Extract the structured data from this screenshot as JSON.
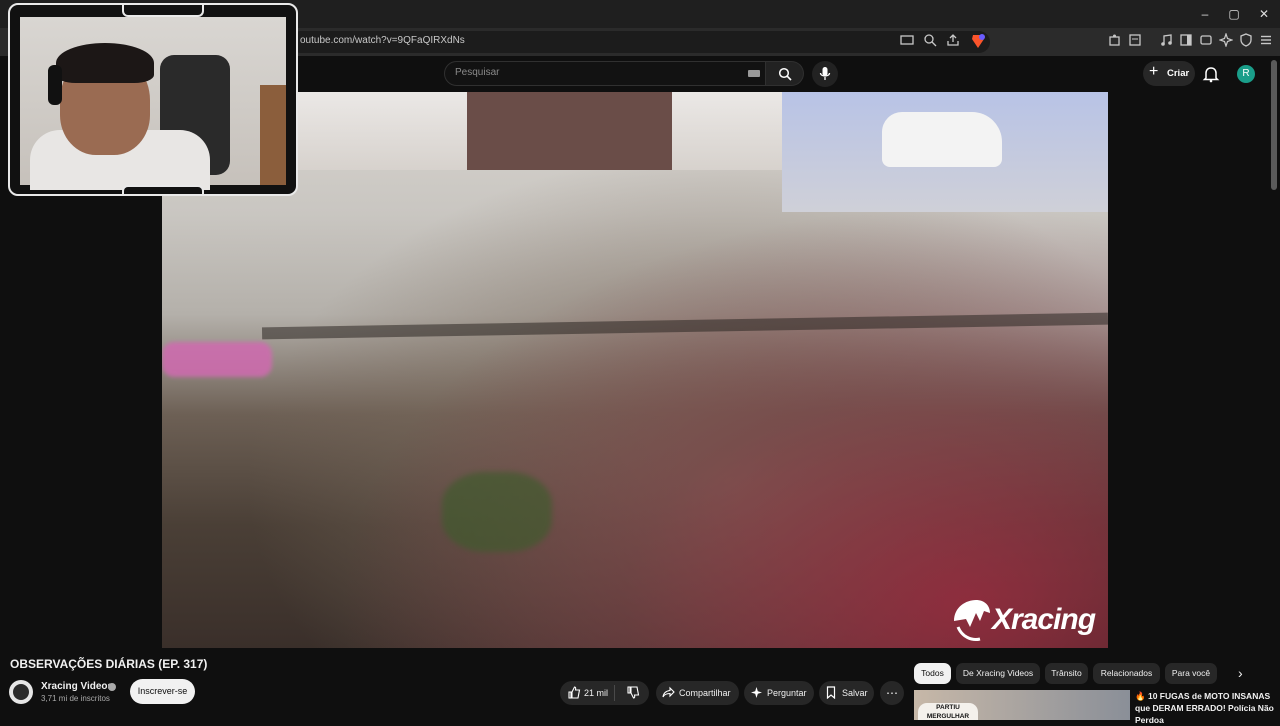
{
  "browser": {
    "url": "outube.com/watch?v=9QFaQIRXdNs",
    "window_controls": [
      "–",
      "▢",
      "✕"
    ],
    "menu_icon": "hamburger-icon"
  },
  "header": {
    "search_placeholder": "Pesquisar",
    "create_label": "Criar",
    "avatar_letter": "R"
  },
  "video": {
    "watermark": "Xracing",
    "title": "OBSERVAÇÕES DIÁRIAS (EP. 317)"
  },
  "channel": {
    "name": "Xracing Videos",
    "subscribers": "3,71 mi de inscritos",
    "subscribe_label": "Inscrever-se"
  },
  "actions": {
    "likes": "21 mil",
    "share": "Compartilhar",
    "ask": "Perguntar",
    "save": "Salvar",
    "more": "⋯"
  },
  "chips": [
    "Todos",
    "De Xracing Videos",
    "Trânsito",
    "Relacionados",
    "Para você"
  ],
  "recommendation": {
    "thumb_badge": "PARTIU MERGULHAR",
    "title": "10 FUGAS de MOTO INSANAS que DERAM ERRADO!",
    "title_tail": "Polícia Não Perdoa"
  },
  "colors": {
    "accent": "#ff0000",
    "avatar_bg": "#1a9e8a",
    "surface": "#0f0f0f"
  }
}
